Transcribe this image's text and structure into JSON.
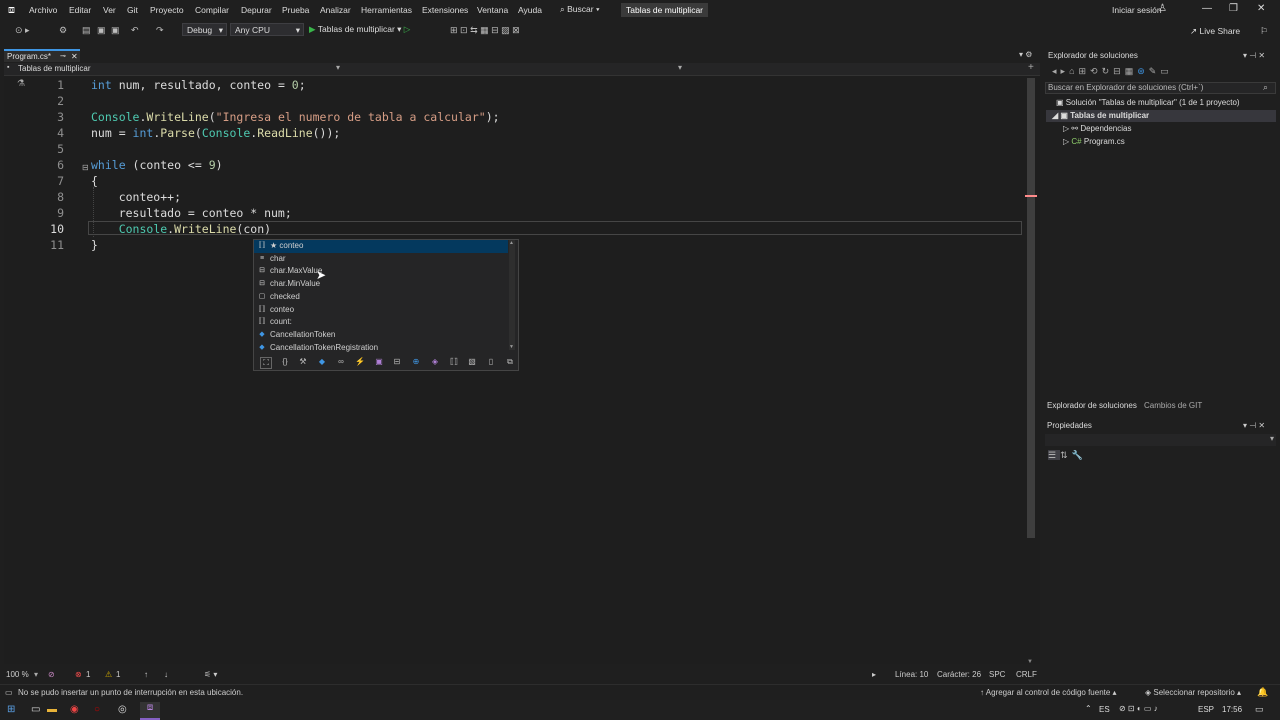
{
  "menu": {
    "items": [
      "Archivo",
      "Editar",
      "Ver",
      "Git",
      "Proyecto",
      "Compilar",
      "Depurar",
      "Prueba",
      "Analizar",
      "Herramientas",
      "Extensiones",
      "Ventana",
      "Ayuda"
    ],
    "search": "Buscar",
    "project_title": "Tablas de multiplicar",
    "sign_in": "Iniciar sesión",
    "live_share": "Live Share"
  },
  "toolbar": {
    "config": "Debug",
    "platform": "Any CPU",
    "run_target": "Tablas de multiplicar"
  },
  "tabs": {
    "file": "Program.cs*",
    "nav": "Tablas de multiplicar"
  },
  "code": {
    "line_numbers": [
      "1",
      "2",
      "3",
      "4",
      "5",
      "6",
      "7",
      "8",
      "9",
      "10",
      "11"
    ],
    "lines": [
      {
        "tokens": [
          [
            "kw",
            "int"
          ],
          [
            "vr",
            " num, resultado, conteo = "
          ],
          [
            "nm",
            "0"
          ],
          [
            "vr",
            ";"
          ]
        ]
      },
      {
        "tokens": []
      },
      {
        "tokens": [
          [
            "ty",
            "Console"
          ],
          [
            "vr",
            "."
          ],
          [
            "fn",
            "WriteLine"
          ],
          [
            "vr",
            "("
          ],
          [
            "st",
            "\"Ingresa el numero de tabla a calcular\""
          ],
          [
            "vr",
            ");"
          ]
        ]
      },
      {
        "tokens": [
          [
            "vr",
            "num = "
          ],
          [
            "kw",
            "int"
          ],
          [
            "vr",
            "."
          ],
          [
            "fn",
            "Parse"
          ],
          [
            "vr",
            "("
          ],
          [
            "ty",
            "Console"
          ],
          [
            "vr",
            "."
          ],
          [
            "fn",
            "ReadLine"
          ],
          [
            "vr",
            "());"
          ]
        ]
      },
      {
        "tokens": []
      },
      {
        "tokens": [
          [
            "kw",
            "while"
          ],
          [
            "vr",
            " (conteo <= "
          ],
          [
            "nm",
            "9"
          ],
          [
            "vr",
            ")"
          ]
        ]
      },
      {
        "tokens": [
          [
            "vr",
            "{"
          ]
        ]
      },
      {
        "tokens": [
          [
            "vr",
            "    conteo++;"
          ]
        ]
      },
      {
        "tokens": [
          [
            "vr",
            "    resultado = conteo * num;"
          ]
        ]
      },
      {
        "tokens": [
          [
            "vr",
            "    "
          ],
          [
            "ty",
            "Console"
          ],
          [
            "vr",
            "."
          ],
          [
            "fn",
            "WriteLine"
          ],
          [
            "vr",
            "(con)"
          ]
        ]
      },
      {
        "tokens": [
          [
            "vr",
            "}"
          ]
        ]
      }
    ]
  },
  "intellisense": {
    "items": [
      {
        "icon": "field-icon",
        "label": "★ conteo",
        "selected": true
      },
      {
        "icon": "struct-icon",
        "label": "char",
        "selected": false
      },
      {
        "icon": "constant-icon",
        "label": "char.MaxValue",
        "selected": false
      },
      {
        "icon": "constant-icon",
        "label": "char.MinValue",
        "selected": false
      },
      {
        "icon": "keyword-icon",
        "label": "checked",
        "selected": false
      },
      {
        "icon": "local-icon",
        "label": "conteo",
        "selected": false
      },
      {
        "icon": "local-icon",
        "label": "count:",
        "selected": false
      },
      {
        "icon": "class-icon",
        "label": "CancellationToken",
        "selected": false
      },
      {
        "icon": "class-icon",
        "label": "CancellationTokenRegistration",
        "selected": false
      }
    ]
  },
  "editor_status": {
    "zoom": "100 %",
    "errors": "1",
    "warnings": "1",
    "line": "Línea: 10",
    "char": "Carácter: 26",
    "spc": "SPC",
    "crlf": "CRLF"
  },
  "solution": {
    "title": "Explorador de soluciones",
    "search": "Buscar en Explorador de soluciones (Ctrl+`)",
    "solution_label": "Solución \"Tablas de multiplicar\" (1 de 1 proyecto)",
    "project": "Tablas de multiplicar",
    "deps": "Dependencias",
    "file": "Program.cs",
    "file_prefix": "C#",
    "tab1": "Explorador de soluciones",
    "tab2": "Cambios de GIT"
  },
  "properties": {
    "title": "Propiedades"
  },
  "statusbar": {
    "message": "No se pudo insertar un punto de interrupción en esta ubicación.",
    "source_control": "Agregar al control de código fuente",
    "repo": "Seleccionar repositorio"
  },
  "taskbar": {
    "lang": "ES",
    "kbd": "ESP",
    "time": "17:56"
  },
  "colors": {
    "accent": "#3f96e4",
    "vs_purple": "#8661c5"
  }
}
